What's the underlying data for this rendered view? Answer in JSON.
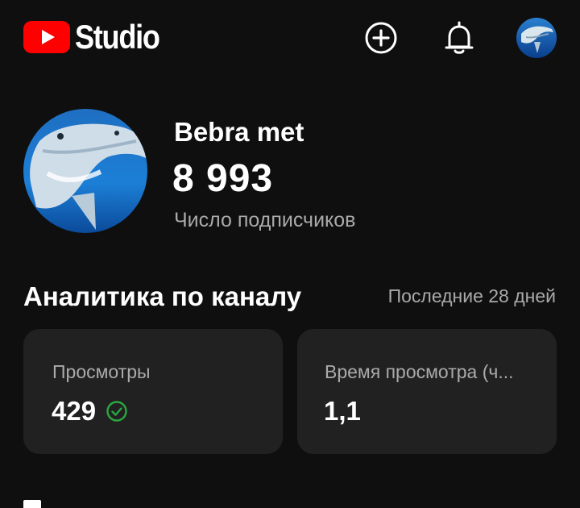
{
  "header": {
    "logo_text": "Studio",
    "icons": [
      "youtube-logo-icon",
      "create-icon",
      "notifications-bell-icon",
      "account-avatar"
    ]
  },
  "channel": {
    "name": "Bebra met",
    "subscriber_count": "8 993",
    "subscriber_label": "Число подписчиков"
  },
  "analytics": {
    "title": "Аналитика по каналу",
    "period": "Последние 28 дней",
    "cards": [
      {
        "label": "Просмотры",
        "value": "429",
        "status_icon": "check-circle-icon"
      },
      {
        "label": "Время просмотра (ч...",
        "value": "1,1"
      }
    ]
  },
  "colors": {
    "background": "#0f0f0f",
    "card": "#212121",
    "brand_red": "#ff0000",
    "success_green": "#2ba640",
    "secondary_text": "#aaaaaa"
  }
}
